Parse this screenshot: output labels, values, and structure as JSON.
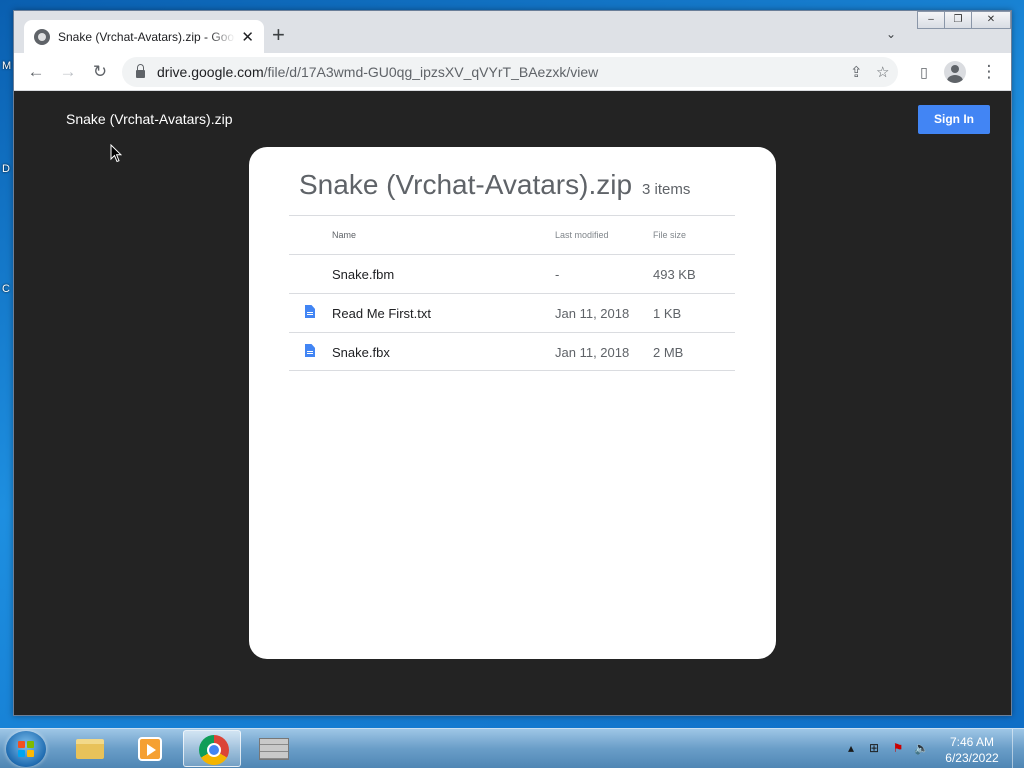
{
  "desktop": {
    "left_letters": [
      "M",
      "D",
      "C"
    ]
  },
  "browser": {
    "tab_title": "Snake (Vrchat-Avatars).zip - Google Drive",
    "url_host": "drive.google.com",
    "url_path": "/file/d/17A3wmd-GU0qg_ipzsXV_qVYrT_BAezxk/view",
    "window_controls": [
      "minimize",
      "restore",
      "close"
    ]
  },
  "page": {
    "doc_title": "Snake (Vrchat-Avatars).zip",
    "signin_label": "Sign In",
    "archive_name": "Snake (Vrchat-Avatars).zip",
    "item_count": "3 items",
    "columns": {
      "name": "Name",
      "modified": "Last modified",
      "size": "File size"
    },
    "files": [
      {
        "name": "Snake.fbm",
        "modified": "-",
        "size": "493 KB",
        "icon": "folder-none"
      },
      {
        "name": "Read Me First.txt",
        "modified": "Jan 11, 2018",
        "size": "1 KB",
        "icon": "document-icon"
      },
      {
        "name": "Snake.fbx",
        "modified": "Jan 11, 2018",
        "size": "2 MB",
        "icon": "document-icon"
      }
    ]
  },
  "taskbar": {
    "apps": [
      "windows-explorer",
      "media-player",
      "google-chrome",
      "firewall"
    ],
    "active_app": "google-chrome",
    "time": "7:46 AM",
    "date": "6/23/2022"
  },
  "colors": {
    "signin": "#4285f4",
    "viewer_bg": "#232323",
    "doc_icon": "#4285f4"
  }
}
